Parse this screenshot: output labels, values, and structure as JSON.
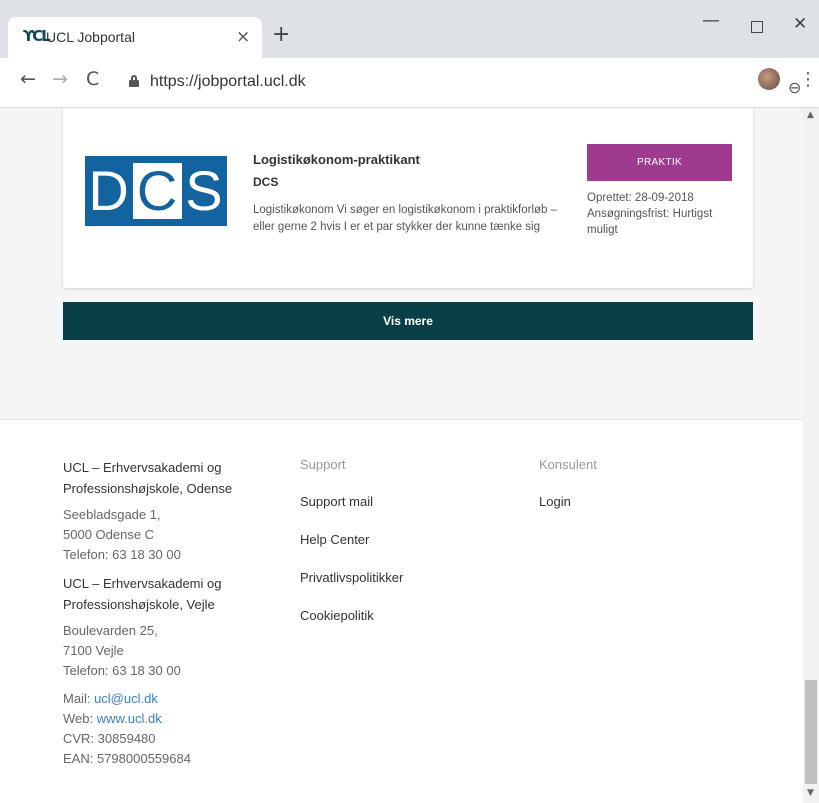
{
  "browser": {
    "tab_favicon": "ϒCL",
    "tab_title": "UCL Jobportal",
    "tab_close": "×",
    "new_tab": "+",
    "win_minimize": "—",
    "win_close": "✕",
    "nav_back": "←",
    "nav_forward": "→",
    "nav_reload": "C",
    "url": "https://jobportal.ucl.dk",
    "zoom_icon": "⊖",
    "star_icon": "☆",
    "menu_icon": "⋮",
    "scroll_up": "▲",
    "scroll_down": "▼"
  },
  "job": {
    "logo_letters": [
      "D",
      "C",
      "S"
    ],
    "title": "Logistikøkonom-praktikant",
    "company": "DCS",
    "description": "Logistikøkonom Vi søger en logistikøkonom i praktikforløb – eller gerne 2 hvis I er et par stykker der kunne tænke sig",
    "tag": "PRAKTIK",
    "tag_color": "#9e3b8e",
    "created": "Oprettet: 28-09-2018",
    "deadline": "Ansøgningsfrist: Hurtigst muligt"
  },
  "vis_mere": "Vis mere",
  "footer": {
    "school1_line1": "UCL – Erhvervsakademi og",
    "school1_line2": "Professionshøjskole, Odense",
    "addr1_street": "Seebladsgade 1,",
    "addr1_city": "5000 Odense C",
    "addr1_phone": "Telefon: 63 18 30 00",
    "school2_line1": "UCL – Erhvervsakademi og",
    "school2_line2": "Professionshøjskole, Vejle",
    "addr2_street": "Boulevarden 25,",
    "addr2_city": "7100 Vejle",
    "addr2_phone": "Telefon: 63 18 30 00",
    "mail_label": "Mail: ",
    "mail_value": "ucl@ucl.dk",
    "web_label": "Web: ",
    "web_value": "www.ucl.dk",
    "cvr": "CVR: 30859480",
    "ean": "EAN: 5798000559684",
    "support_heading": "Support",
    "support_links": [
      "Support mail",
      "Help Center",
      "Privatlivspolitikker",
      "Cookiepolitik"
    ],
    "konsulent_heading": "Konsulent",
    "konsulent_links": [
      "Login"
    ]
  },
  "colors": {
    "button_bg": "#0b3f47",
    "logo_bg": "#1363a0",
    "link": "#3a7fc0"
  }
}
